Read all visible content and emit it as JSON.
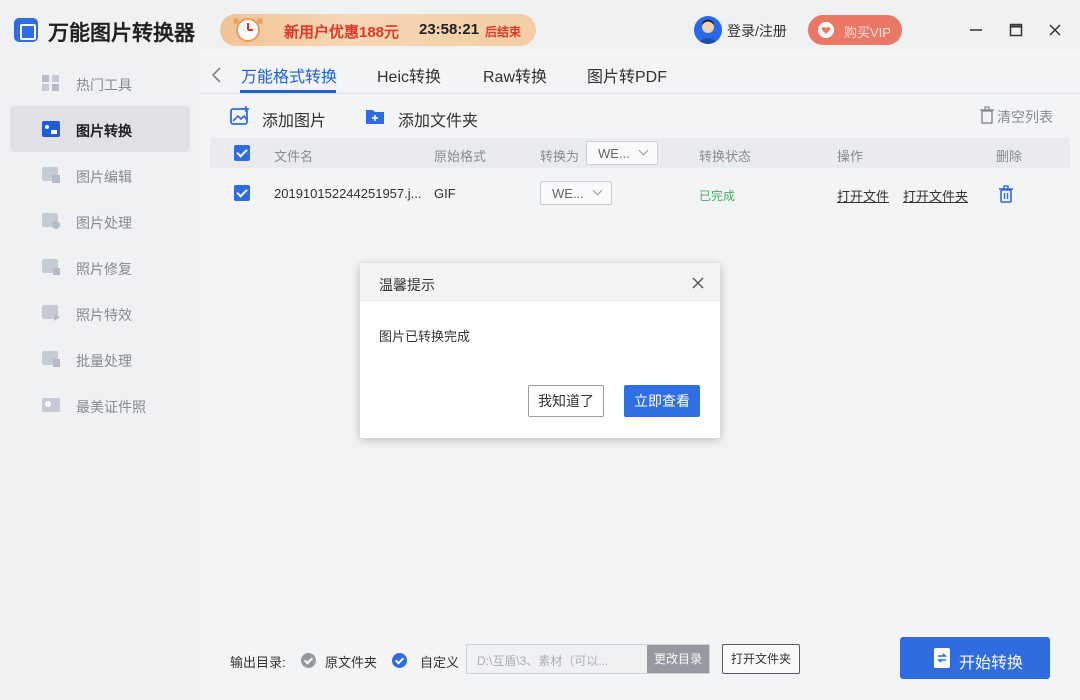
{
  "app": {
    "title": "万能图片转换器"
  },
  "promo": {
    "text": "新用户优惠188元",
    "timer": "23:58:21",
    "ends": "后结束"
  },
  "header": {
    "login": "登录/注册",
    "vip": "购买VIP"
  },
  "sidebar": {
    "items": [
      {
        "label": "热门工具",
        "icon": "grid-icon"
      },
      {
        "label": "图片转换",
        "icon": "image-convert-icon"
      },
      {
        "label": "图片编辑",
        "icon": "image-edit-icon"
      },
      {
        "label": "图片处理",
        "icon": "image-process-icon"
      },
      {
        "label": "照片修复",
        "icon": "photo-repair-icon"
      },
      {
        "label": "照片特效",
        "icon": "photo-effect-icon"
      },
      {
        "label": "批量处理",
        "icon": "batch-icon"
      },
      {
        "label": "最美证件照",
        "icon": "id-photo-icon"
      }
    ],
    "active_index": 1
  },
  "tabs": [
    {
      "label": "万能格式转换"
    },
    {
      "label": "Heic转换"
    },
    {
      "label": "Raw转换"
    },
    {
      "label": "图片转PDF"
    }
  ],
  "toolbar": {
    "add_image": "添加图片",
    "add_folder": "添加文件夹",
    "clear_list": "清空列表"
  },
  "table": {
    "headers": {
      "filename": "文件名",
      "original_format": "原始格式",
      "convert_to": "转换为",
      "convert_to_value": "WE...",
      "status": "转换状态",
      "actions": "操作",
      "delete": "删除"
    },
    "rows": [
      {
        "filename": "201910152244251957.j...",
        "original_format": "GIF",
        "convert_to": "WE...",
        "status": "已完成",
        "open_file": "打开文件",
        "open_folder": "打开文件夹"
      }
    ]
  },
  "footer": {
    "output_label": "输出目录:",
    "opt_original": "原文件夹",
    "opt_custom": "自定义",
    "path": "D:\\互盾\\3、素材（可以...",
    "change_dir": "更改目录",
    "open_folder": "打开文件夹",
    "start": "开始转换"
  },
  "dialog": {
    "title": "温馨提示",
    "message": "图片已转换完成",
    "btn_ok": "我知道了",
    "btn_view": "立即查看"
  },
  "colors": {
    "accent": "#2f6fe4",
    "vip": "#f07a6a",
    "success": "#4caf6a"
  }
}
